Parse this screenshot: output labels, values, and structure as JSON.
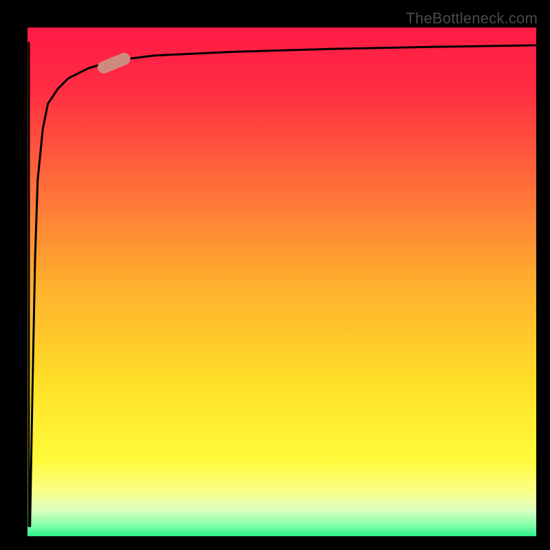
{
  "watermark": {
    "text": "TheBottleneck.com"
  },
  "chart_data": {
    "type": "area",
    "title": "",
    "xlabel": "",
    "ylabel": "",
    "xlim": [
      0,
      100
    ],
    "ylim": [
      0,
      100
    ],
    "grid": false,
    "gradient": {
      "direction": "top-to-bottom",
      "stops": [
        {
          "pos": 0.0,
          "color": "#ff1b45"
        },
        {
          "pos": 0.12,
          "color": "#ff2c42"
        },
        {
          "pos": 0.3,
          "color": "#ff6a3a"
        },
        {
          "pos": 0.5,
          "color": "#ffae2e"
        },
        {
          "pos": 0.7,
          "color": "#ffe028"
        },
        {
          "pos": 0.85,
          "color": "#fffb3a"
        },
        {
          "pos": 0.91,
          "color": "#fbff87"
        },
        {
          "pos": 0.95,
          "color": "#d9ffc0"
        },
        {
          "pos": 0.98,
          "color": "#7dffa8"
        },
        {
          "pos": 1.0,
          "color": "#27f18a"
        }
      ]
    },
    "series": [
      {
        "name": "curve",
        "color": "#000000",
        "x": [
          0.5,
          1,
          1.5,
          2,
          3,
          4,
          6,
          8,
          12,
          17,
          25,
          40,
          60,
          80,
          100
        ],
        "y": [
          2,
          30,
          55,
          70,
          80,
          85,
          88,
          90,
          92,
          93.5,
          94.5,
          95.2,
          95.8,
          96.2,
          96.5
        ]
      }
    ],
    "annotations": [
      {
        "name": "marker-pill",
        "shape": "pill",
        "color": "#cf8a80",
        "x_center": 17,
        "y_center": 93,
        "angle_deg": -22
      }
    ]
  }
}
